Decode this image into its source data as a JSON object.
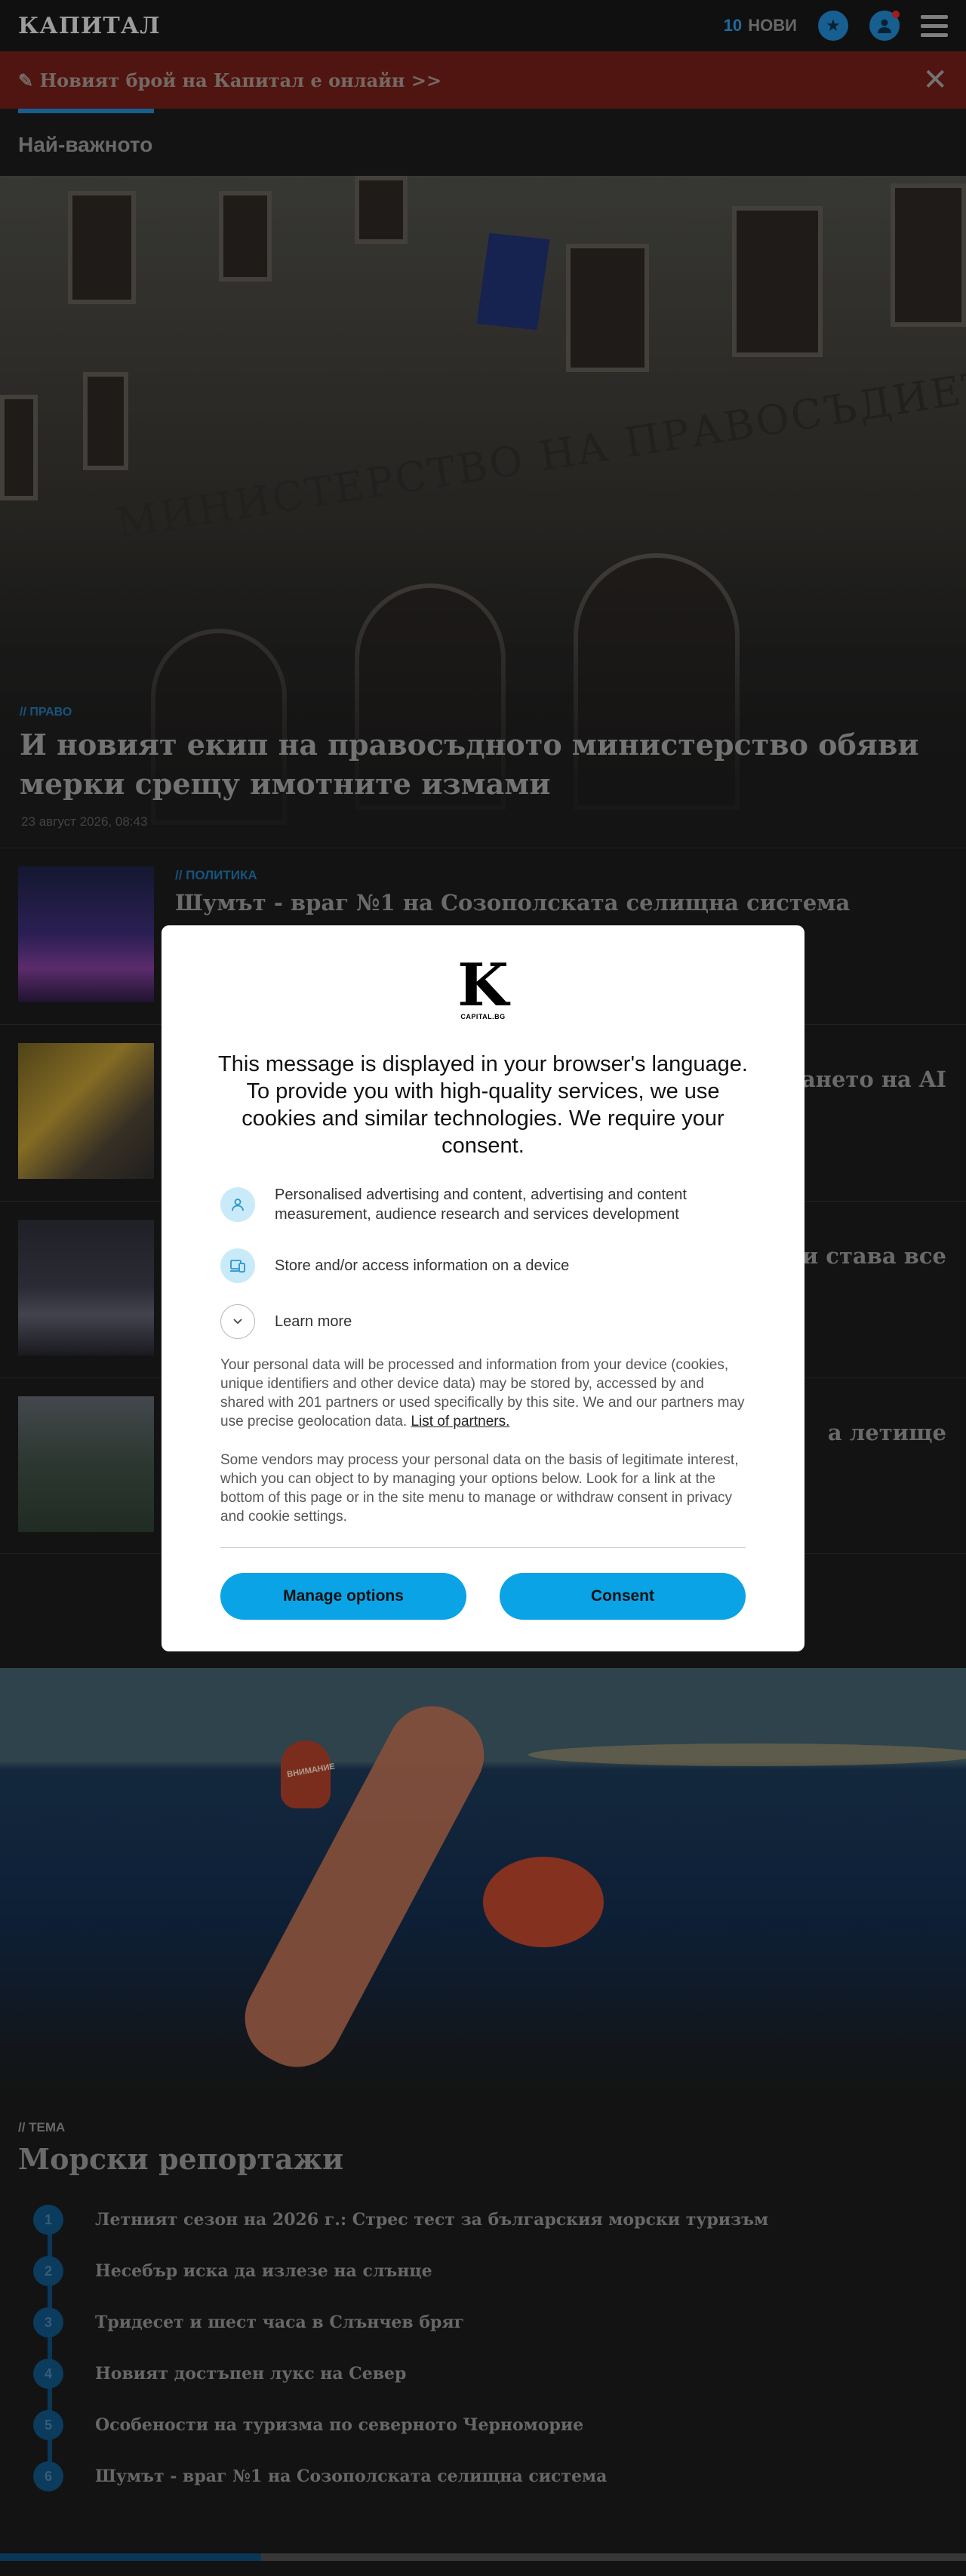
{
  "header": {
    "logo": "КАПИТАЛ",
    "news_count": "10",
    "news_label": "НОВИ"
  },
  "promo": {
    "icon": "✎",
    "text": "Новият брой на Капитал е онлайн >>",
    "close": "✕"
  },
  "section": {
    "title": "Най-важното"
  },
  "hero": {
    "tag": "// ПРАВО",
    "sign": "МИНИСТЕРСТВО НА ПРАВОСЪДИЕТО",
    "title": "И новият екип на правосъдното министерство обяви мерки срещу имотните измами",
    "date": "23 август 2026, 08:43"
  },
  "articles": [
    {
      "tag": "// ПОЛИТИКА",
      "title": "Шумът - враг №1 на Созополската селищна система"
    },
    {
      "title": "ането на AI"
    },
    {
      "title": "ли става все"
    },
    {
      "title": "а летище"
    }
  ],
  "sea": {
    "buoy_label": "ВНИМАНИЕ"
  },
  "topic": {
    "tag": "// ТЕМА",
    "title": "Морски репортажи",
    "items": [
      {
        "num": "1",
        "title": "Летният сезон на 2026 г.: Стрес тест за българския морски туризъм"
      },
      {
        "num": "2",
        "title": "Несебър иска да излезе на слънце"
      },
      {
        "num": "3",
        "title": "Тридесет и шест часа в Слънчев бряг"
      },
      {
        "num": "4",
        "title": "Новият достъпен лукс на Север"
      },
      {
        "num": "5",
        "title": "Особености на туризма по северното Черноморие"
      },
      {
        "num": "6",
        "title": "Шумът - враг №1 на Созополската селищна система"
      }
    ]
  },
  "consent": {
    "logo_letter": "K",
    "logo_sub": "CAPITAL.BG",
    "heading": "This message is displayed in your browser's language. To provide you with high-quality services, we use cookies and similar technologies. We require your consent.",
    "purposes": [
      {
        "icon": "person-icon",
        "text": "Personalised advertising and content, advertising and content measurement, audience research and services development"
      },
      {
        "icon": "device-icon",
        "text": "Store and/or access information on a device"
      },
      {
        "icon": "chevron-down-icon",
        "text": "Learn more"
      }
    ],
    "para1": "Your personal data will be processed and information from your device (cookies, unique identifiers and other device data) may be stored by, accessed by and shared with 201 partners or used specifically by this site. We and our partners may use precise geolocation data.",
    "partners_link": "List of partners.",
    "para2": "Some vendors may process your personal data on the basis of legitimate interest, which you can object to by managing your options below. Look for a link at the bottom of this page or in the site menu to manage or withdraw consent in privacy and cookie settings.",
    "manage_label": "Manage options",
    "consent_label": "Consent"
  },
  "colors": {
    "accent": "#0aa3e6",
    "brand_blue": "#1f7fc0",
    "promo_bg": "#6b1d16"
  }
}
